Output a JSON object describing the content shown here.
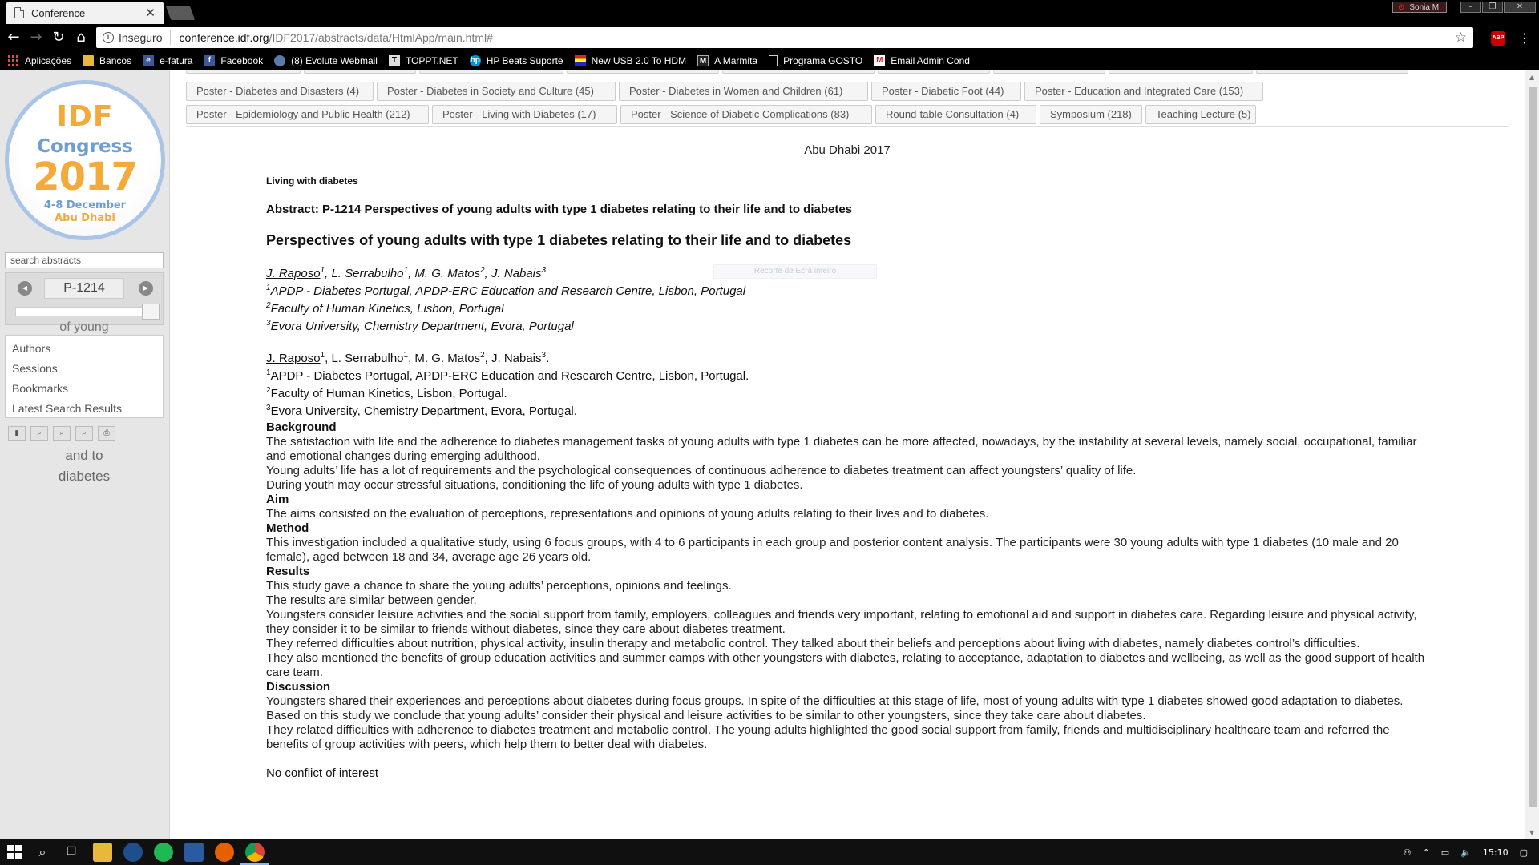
{
  "browser": {
    "tab_title": "Conference",
    "tab_close": "✕",
    "profile_name": "Sonia M.",
    "url_security": "Inseguro",
    "url_domain": "conference.idf.org",
    "url_path": "/IDF2017/abstracts/data/HtmlApp/main.html#",
    "extension_badge": "ABP"
  },
  "bookmarks": [
    {
      "label": "Aplicações",
      "icon": "apps-grid-icon"
    },
    {
      "label": "Bancos",
      "icon": "folder-icon"
    },
    {
      "label": "e-fatura",
      "icon": "efatura-icon"
    },
    {
      "label": "Facebook",
      "icon": "facebook-icon"
    },
    {
      "label": "(8) Evolute Webmail",
      "icon": "webmail-icon"
    },
    {
      "label": "TOPPT.NET",
      "icon": "toppt-icon"
    },
    {
      "label": "HP Beats Suporte",
      "icon": "hp-icon"
    },
    {
      "label": "New USB 2.0 To HDM",
      "icon": "usb-icon"
    },
    {
      "label": "A Marmita",
      "icon": "marmita-icon"
    },
    {
      "label": "Programa GOSTO",
      "icon": "document-icon"
    },
    {
      "label": "Email Admin Cond",
      "icon": "gmail-icon"
    }
  ],
  "sidebar": {
    "logo": {
      "l1": "IDF",
      "l2": "Congress",
      "l3": "2017",
      "l4": "4-8 December",
      "l5": "Abu Dhabi"
    },
    "search_placeholder": "search abstracts",
    "abstract_id": "P-1214",
    "ghost_top": "of young",
    "menu": [
      "Authors",
      "Sessions",
      "Bookmarks",
      "Latest Search Results"
    ],
    "ghost_bottom_1": "and to",
    "ghost_bottom_2": "diabetes"
  },
  "tabs": {
    "row1": [
      "Poster - Diabetes and Disasters (4)",
      "Poster - Diabetes in Society and Culture (45)",
      "Poster - Diabetes in Women and Children (61)",
      "Poster - Diabetic Foot (44)",
      "Poster - Education and Integrated Care (153)"
    ],
    "row2": [
      "Poster - Epidemiology and Public Health (212)",
      "Poster - Living with Diabetes (17)",
      "Poster - Science of Diabetic Complications (83)",
      "Round-table Consultation (4)",
      "Symposium (218)",
      "Teaching Lecture (5)"
    ]
  },
  "article": {
    "venue": "Abu Dhabi 2017",
    "category": "Living with diabetes",
    "heading": "Abstract: P-1214 Perspectives of young adults with type 1 diabetes relating to their life and to diabetes",
    "title": "Perspectives of young adults with type 1 diabetes relating to their life and to diabetes",
    "authors_a": {
      "first": "J. Raposo",
      "rest": [
        ", L. Serrabulho",
        ", M. G. Matos",
        ", J. Nabais"
      ],
      "affiliations": [
        "APDP - Diabetes Portugal, APDP-ERC Education and Research Centre, Lisbon, Portugal",
        "Faculty of Human Kinetics, Lisbon, Portugal",
        "Evora University, Chemistry Department, Evora, Portugal"
      ]
    },
    "authors_b": {
      "first": "J. Raposo",
      "rest": [
        ", L. Serrabulho",
        ", M. G. Matos",
        ", J. Nabais"
      ],
      "end": ".",
      "affiliations": [
        "APDP - Diabetes Portugal, APDP-ERC Education and Research Centre, Lisbon, Portugal.",
        "Faculty of Human Kinetics, Lisbon, Portugal.",
        "Evora University, Chemistry Department, Evora, Portugal."
      ]
    },
    "sections": [
      {
        "heading": "Background",
        "paragraphs": [
          "The satisfaction with life and the adherence to diabetes management tasks of young adults with type 1 diabetes can be more affected, nowadays, by the instability at several levels, namely social, occupational, familiar and emotional changes during emerging adulthood.",
          "Young adults’ life has a lot of requirements and the psychological consequences of continuous adherence to diabetes treatment can affect youngsters’ quality of life.",
          "During youth may occur stressful situations, conditioning the life of young adults with type 1 diabetes."
        ]
      },
      {
        "heading": "Aim",
        "paragraphs": [
          "The aims consisted on the evaluation of perceptions, representations and opinions of young adults relating to their lives and to diabetes."
        ]
      },
      {
        "heading": "Method",
        "paragraphs": [
          "This investigation included a qualitative study, using 6 focus groups, with 4 to 6 participants in each group and posterior content analysis. The participants were 30 young adults with type 1 diabetes (10 male and 20 female), aged between 18 and 34, average age 26 years old."
        ]
      },
      {
        "heading": "Results",
        "paragraphs": [
          "This study gave a chance to share the young adults’ perceptions, opinions and feelings.",
          "The results are similar between gender.",
          "Youngsters consider leisure activities and the social support from family, employers, colleagues and friends very important, relating to emotional aid and support in diabetes care. Regarding leisure and physical activity, they consider it to be similar to friends without diabetes, since they care about diabetes treatment.",
          "They referred difficulties about nutrition, physical activity, insulin therapy and metabolic control. They talked about their beliefs and perceptions about living with diabetes, namely diabetes control’s difficulties.",
          "They also mentioned the benefits of group education activities and summer camps with other youngsters with diabetes, relating to acceptance, adaptation to diabetes and wellbeing, as well as the good support of health care team."
        ]
      },
      {
        "heading": "Discussion",
        "paragraphs": [
          "Youngsters shared their experiences and perceptions about diabetes during focus groups. In spite of the difficulties at this stage of life, most of young adults with type 1 diabetes showed good adaptation to diabetes.",
          "Based on this study we conclude that young adults’ consider their physical and leisure activities to be similar to other youngsters, since they take care about diabetes.",
          "They related difficulties with adherence to diabetes treatment and metabolic control. The young adults highlighted the good social support from family, friends and multidisciplinary healthcare team and referred the benefits of group activities with peers, which help them to better deal with diabetes."
        ]
      }
    ],
    "conflict": "No conflict of interest"
  },
  "overlay_hint": "Recorte de Ecrã inteiro",
  "taskbar": {
    "clock": "15:10"
  }
}
